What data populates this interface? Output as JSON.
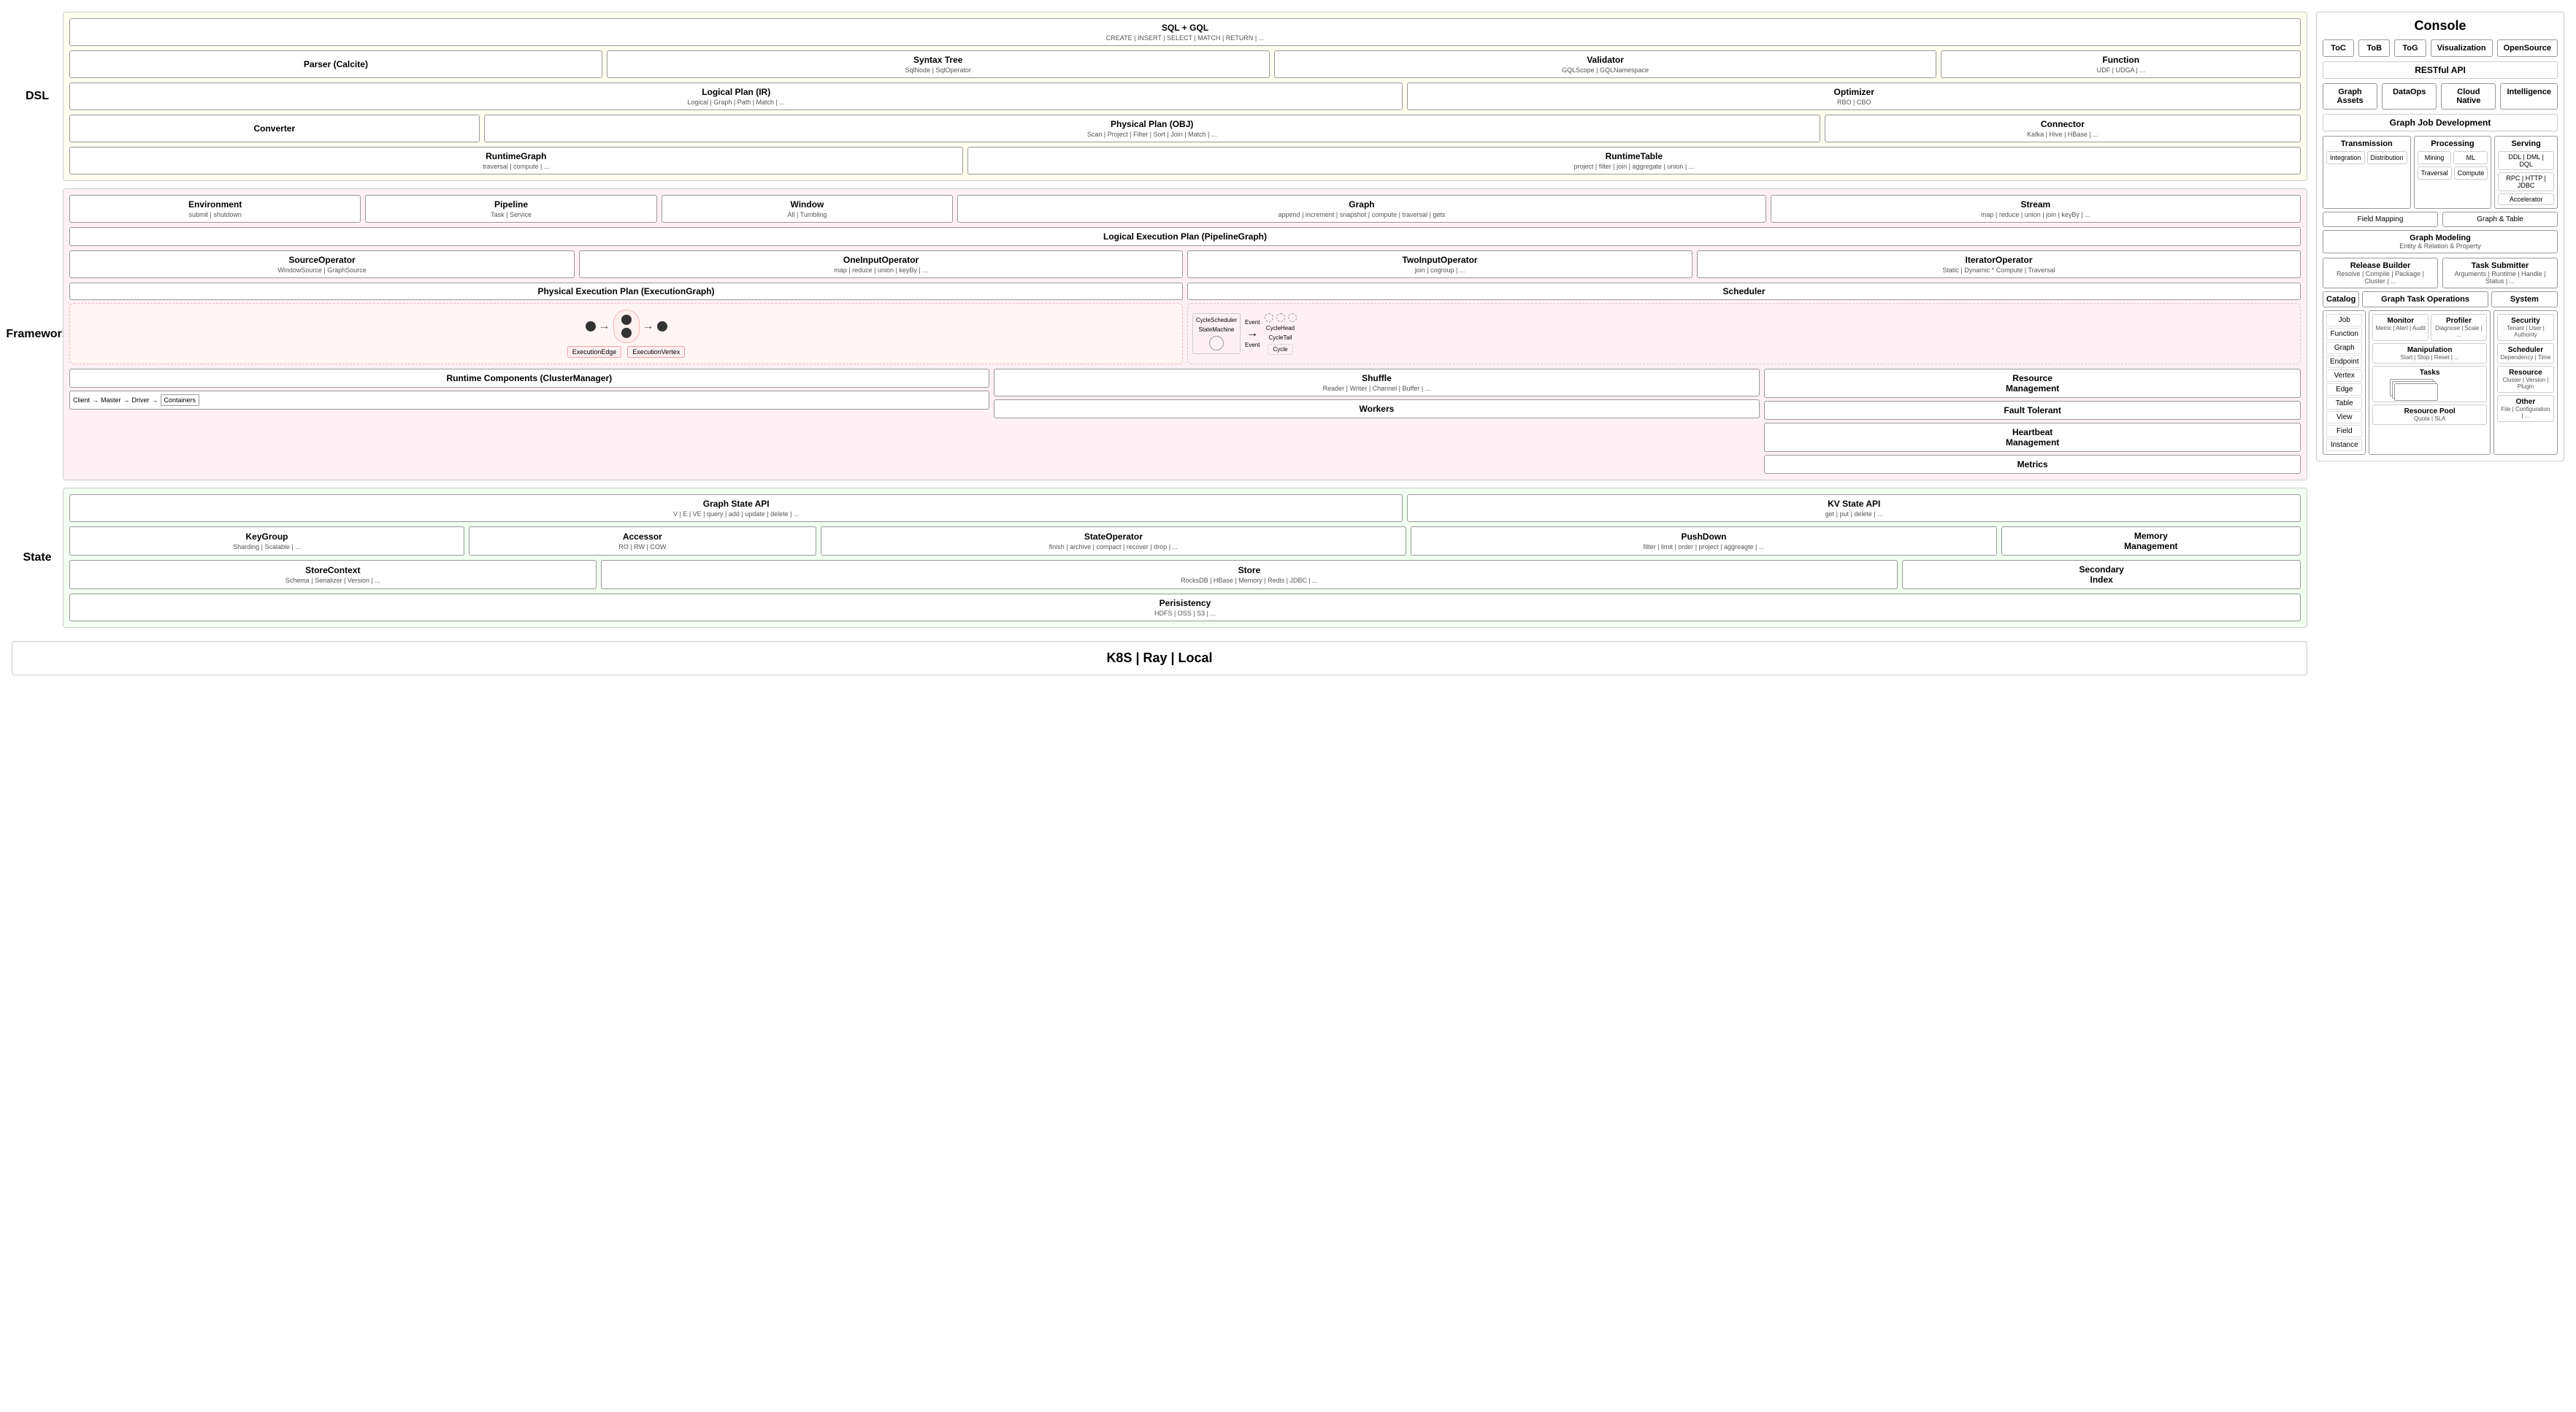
{
  "dsl": {
    "label": "DSL",
    "sql_gql": {
      "title": "SQL + GQL",
      "subtitle": "CREATE | INSERT | SELECT | MATCH | RETURN | ..."
    },
    "parser": {
      "title": "Parser (Calcite)"
    },
    "syntax_tree": {
      "title": "Syntax Tree",
      "subtitle": "SqlNode | SqlOperator"
    },
    "validator": {
      "title": "Validator",
      "subtitle": "GQLScope | GQLNamespace"
    },
    "function": {
      "title": "Function",
      "subtitle": "UDF | UDGA | ..."
    },
    "logical_plan": {
      "title": "Logical Plan (IR)",
      "subtitle": "Logical | Graph | Path | Match | ..."
    },
    "optimizer": {
      "title": "Optimizer",
      "subtitle": "RBO | CBO"
    },
    "converter": {
      "title": "Converter"
    },
    "physical_plan": {
      "title": "Physical Plan (OBJ)",
      "subtitle": "Scan | Project | Filter | Sort | Join | Match | ..."
    },
    "connector": {
      "title": "Connector",
      "subtitle": "Kafka | Hive | HBase | ..."
    },
    "runtime_graph": {
      "title": "RuntimeGraph",
      "subtitle": "traversal | compute | ..."
    },
    "runtime_table": {
      "title": "RuntimeTable",
      "subtitle": "project | filter | join | aggregate | union | ..."
    }
  },
  "framework": {
    "label": "Framework",
    "environment": {
      "title": "Environment",
      "subtitle": "submit | shutdown"
    },
    "pipeline": {
      "title": "Pipeline",
      "subtitle": "Task | Service"
    },
    "window": {
      "title": "Window",
      "subtitle": "All | Tumbling"
    },
    "graph": {
      "title": "Graph",
      "subtitle": "append | increment | snapshot | compute | traversal | gets"
    },
    "stream": {
      "title": "Stream",
      "subtitle": "map | reduce | union | join | keyBy | ..."
    },
    "lep_title": "Logical Execution Plan (PipelineGraph)",
    "source_op": {
      "title": "SourceOperator",
      "subtitle": "WindowSource | GraphSource"
    },
    "oneinput_op": {
      "title": "OneInputOperator",
      "subtitle": "map | reduce | union | keyBy | ..."
    },
    "twoinput_op": {
      "title": "TwoInputOperator",
      "subtitle": "join | cogroup | ..."
    },
    "iterator_op": {
      "title": "IteratorOperator",
      "subtitle": "Static | Dynamic * Compute | Traversal"
    },
    "pep_title": "Physical Execution Plan (ExecutionGraph)",
    "scheduler_title": "Scheduler",
    "runtime_components_title": "Runtime Components (ClusterManager)",
    "shuffle_title": "Shuffle",
    "shuffle_subtitle": "Reader | Writer | Channel | Buffer | ...",
    "workers_title": "Workers",
    "resource_mgmt": {
      "title": "Resource\nManagement"
    },
    "fault_tolerant": {
      "title": "Fault Tolerant"
    },
    "heartbeat_mgmt": {
      "title": "Heartbeat\nManagement"
    },
    "metrics": {
      "title": "Metrics"
    },
    "cycle_scheduler": "CycleScheduler",
    "state_machine": "StateMachine",
    "cycle_head": "CycleHead",
    "cycle_tail": "CycleTail",
    "cycle": "Cycle",
    "execution_edge": "ExecutionEdge",
    "execution_vertex": "ExecutionVertex",
    "event1": "Event",
    "event2": "Event",
    "client": "Client",
    "master": "Master",
    "driver": "Driver",
    "containers": "Containers"
  },
  "state": {
    "label": "State",
    "graph_state_api": {
      "title": "Graph State API",
      "subtitle": "V | E | VE | query | add | update | delete | ..."
    },
    "kv_state_api": {
      "title": "KV State API",
      "subtitle": "get | put | delete | ..."
    },
    "keygroup": {
      "title": "KeyGroup",
      "subtitle": "Sharding | Scalable | ..."
    },
    "accessor": {
      "title": "Accessor",
      "subtitle": "RO | RW | COW"
    },
    "state_operator": {
      "title": "StateOperator",
      "subtitle": "finish | archive | compact | recover | drop | ..."
    },
    "pushdown": {
      "title": "PushDown",
      "subtitle": "filter | limit | order | project | aggreagte | ..."
    },
    "memory_mgmt": {
      "title": "Memory\nManagement"
    },
    "store_context": {
      "title": "StoreContext",
      "subtitle": "Schema | Serializer | Version | ..."
    },
    "store": {
      "title": "Store",
      "subtitle": "RocksDB | HBase | Memory | Redis | JDBC | ..."
    },
    "secondary_index": {
      "title": "Secondary\nIndex"
    },
    "persistency": {
      "title": "Perisistency",
      "subtitle": "HDFS | OSS | S3 | ..."
    }
  },
  "k8s": {
    "title": "K8S | Ray | Local"
  },
  "console": {
    "title": "Console",
    "tabs": [
      {
        "label": "ToC"
      },
      {
        "label": "ToB"
      },
      {
        "label": "ToG"
      },
      {
        "label": "Visualization"
      },
      {
        "label": "OpenSource"
      }
    ],
    "restful_api": "RESTful API",
    "graph_assets": "Graph Assets",
    "dataops": "DataOps",
    "cloud_native": "Cloud Native",
    "intelligence": "Intelligence",
    "graph_job_dev": "Graph Job Development",
    "transmission": {
      "title": "Transmission",
      "integration": "Integration",
      "distribution": "Distribution"
    },
    "processing": {
      "title": "Processing",
      "mining": "Mining",
      "ml": "ML",
      "traversal": "Traversal",
      "compute": "Compute"
    },
    "serving": {
      "title": "Serving",
      "ddl": "DDL | DML | DQL",
      "rpc": "RPC | HTTP | JDBC",
      "accelerator": "Accelerator"
    },
    "field_mapping": "Field Mapping",
    "graph_table": "Graph & Table",
    "graph_modeling": "Graph Modeling",
    "graph_modeling_sub": "Entity & Relation & Property",
    "release_builder": {
      "title": "Release Builder",
      "subtitle": "Resolve | Compile | Package | Cluster | ..."
    },
    "task_submitter": {
      "title": "Task Submitter",
      "subtitle": "Arguments | Runtime | Handle | Status | ..."
    },
    "catalog": "Catalog",
    "graph_task_ops": "Graph Task Operations",
    "system": "System",
    "catalog_items": [
      "Job",
      "Function",
      "Graph",
      "Endpoint",
      "Vertex",
      "Edge",
      "Table",
      "View",
      "Field",
      "Instance"
    ],
    "monitor": {
      "title": "Monitor",
      "subtitle": "Metric | Alert | Audit"
    },
    "profiler": {
      "title": "Profiler",
      "subtitle": "Diagnose | Scale | ..."
    },
    "manipulation": {
      "title": "Manipulation",
      "subtitle": "Start | Stop | Reset | ..."
    },
    "tasks_title": "Tasks",
    "resource_pool": {
      "title": "Resource Pool",
      "subtitle": "Quota | SLA"
    },
    "security": {
      "title": "Security",
      "subtitle": "Tenant | User | Authority"
    },
    "scheduler_sys": {
      "title": "Scheduler",
      "subtitle": "Dependency | Time"
    },
    "resource_sys": {
      "title": "Resource",
      "subtitle": "Cluster | Version | Plugin"
    },
    "other_sys": {
      "title": "Other",
      "subtitle": "File | Configuration | ..."
    }
  }
}
